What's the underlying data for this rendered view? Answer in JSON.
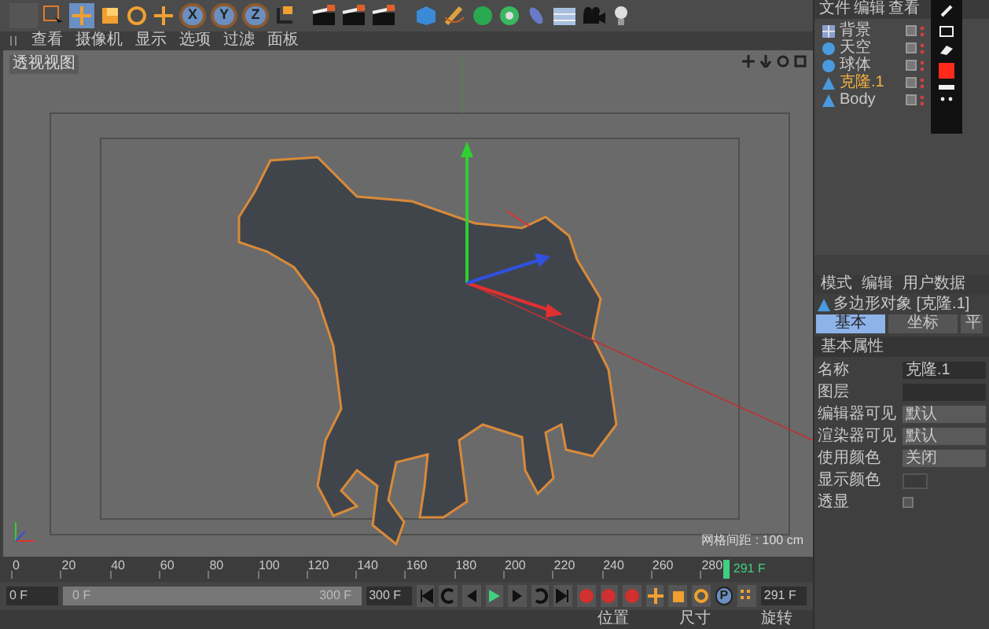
{
  "toolbar": {
    "axis_locks": [
      {
        "label": "X",
        "selected": true
      },
      {
        "label": "Y",
        "selected": true
      },
      {
        "label": "Z",
        "selected": true
      }
    ]
  },
  "viewport": {
    "menu": [
      "查看",
      "摄像机",
      "显示",
      "选项",
      "过滤",
      "面板"
    ],
    "label": "透视视图",
    "grid_spacing": "网格间距 : 100 cm"
  },
  "object_manager": {
    "menu": [
      "文件",
      "编辑",
      "查看"
    ],
    "objects": [
      {
        "name": "背景",
        "kind": "background",
        "selected": false
      },
      {
        "name": "天空",
        "kind": "sphere",
        "selected": false
      },
      {
        "name": "球体",
        "kind": "sphere",
        "selected": false
      },
      {
        "name": "克隆.1",
        "kind": "polygon",
        "selected": true
      },
      {
        "name": "Body",
        "kind": "polygon",
        "selected": false
      }
    ]
  },
  "attributes": {
    "menu": [
      "模式",
      "编辑",
      "用户数据"
    ],
    "title": "多边形对象 [克隆.1]",
    "tabs": [
      {
        "label": "基本",
        "selected": true
      },
      {
        "label": "坐标",
        "selected": false
      },
      {
        "label": "平",
        "selected": false
      }
    ],
    "section": "基本属性",
    "fields": [
      {
        "label": "名称",
        "kind": "text",
        "value": "克隆.1"
      },
      {
        "label": "图层",
        "kind": "text"
      },
      {
        "label": "编辑器可见",
        "kind": "dropdown",
        "value": "默认"
      },
      {
        "label": "渲染器可见",
        "kind": "dropdown",
        "value": "默认"
      },
      {
        "label": "使用颜色",
        "kind": "dropdown",
        "value": "关闭"
      },
      {
        "label": "显示颜色",
        "kind": "color"
      },
      {
        "label": "透显",
        "kind": "checkbox",
        "checked": false
      }
    ]
  },
  "timeline": {
    "ticks": [
      "0",
      "20",
      "40",
      "60",
      "80",
      "100",
      "120",
      "140",
      "160",
      "180",
      "200",
      "220",
      "240",
      "260",
      "280"
    ],
    "current": "291 F",
    "start_field": "0 F",
    "range_slider": {
      "start": "0 F",
      "end": "300 F",
      "level": 1
    },
    "end_field": "300 F",
    "current_field": "291 F",
    "key_button": "P"
  },
  "coordinates": {
    "headers": [
      "位置",
      "尺寸",
      "旋转"
    ]
  }
}
